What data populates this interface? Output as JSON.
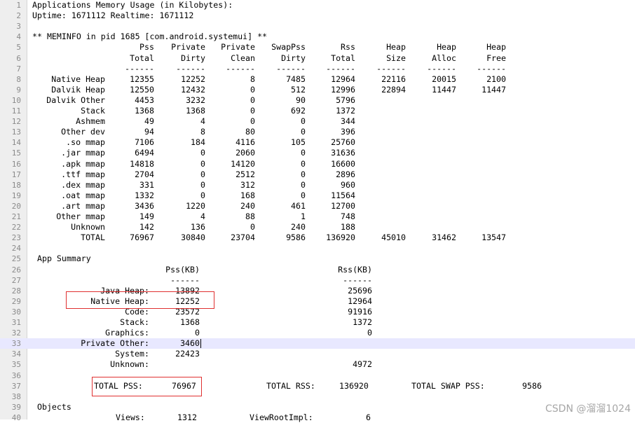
{
  "editor": {
    "lines": [
      {
        "n": "1",
        "text": "Applications Memory Usage (in Kilobytes):"
      },
      {
        "n": "2",
        "text": "Uptime: 1671112 Realtime: 1671112"
      },
      {
        "n": "3",
        "text": ""
      },
      {
        "n": "4",
        "text": "** MEMINFO in pid 1685 [com.android.systemui] **"
      },
      {
        "n": "5",
        "cols": [
          "",
          "Pss",
          "Private",
          "Private",
          "SwapPss",
          "Rss",
          "Heap",
          "Heap",
          "Heap"
        ]
      },
      {
        "n": "6",
        "cols": [
          "",
          "Total",
          "Dirty",
          "Clean",
          "Dirty",
          "Total",
          "Size",
          "Alloc",
          "Free"
        ]
      },
      {
        "n": "7",
        "cols": [
          "",
          "------",
          "------",
          "------",
          "------",
          "------",
          "------",
          "------",
          "------"
        ]
      },
      {
        "n": "8",
        "cols": [
          "Native Heap",
          "12355",
          "12252",
          "8",
          "7485",
          "12964",
          "22116",
          "20015",
          "2100"
        ]
      },
      {
        "n": "9",
        "cols": [
          "Dalvik Heap",
          "12550",
          "12432",
          "0",
          "512",
          "12996",
          "22894",
          "11447",
          "11447"
        ]
      },
      {
        "n": "10",
        "cols": [
          "Dalvik Other",
          "4453",
          "3232",
          "0",
          "90",
          "5796",
          "",
          "",
          ""
        ]
      },
      {
        "n": "11",
        "cols": [
          "Stack",
          "1368",
          "1368",
          "0",
          "692",
          "1372",
          "",
          "",
          ""
        ]
      },
      {
        "n": "12",
        "cols": [
          "Ashmem",
          "49",
          "4",
          "0",
          "0",
          "344",
          "",
          "",
          ""
        ]
      },
      {
        "n": "13",
        "cols": [
          "Other dev",
          "94",
          "8",
          "80",
          "0",
          "396",
          "",
          "",
          ""
        ]
      },
      {
        "n": "14",
        "cols": [
          ".so mmap",
          "7106",
          "184",
          "4116",
          "105",
          "25760",
          "",
          "",
          ""
        ]
      },
      {
        "n": "15",
        "cols": [
          ".jar mmap",
          "6494",
          "0",
          "2060",
          "0",
          "31636",
          "",
          "",
          ""
        ]
      },
      {
        "n": "16",
        "cols": [
          ".apk mmap",
          "14818",
          "0",
          "14120",
          "0",
          "16600",
          "",
          "",
          ""
        ]
      },
      {
        "n": "17",
        "cols": [
          ".ttf mmap",
          "2704",
          "0",
          "2512",
          "0",
          "2896",
          "",
          "",
          ""
        ]
      },
      {
        "n": "18",
        "cols": [
          ".dex mmap",
          "331",
          "0",
          "312",
          "0",
          "960",
          "",
          "",
          ""
        ]
      },
      {
        "n": "19",
        "cols": [
          ".oat mmap",
          "1332",
          "0",
          "168",
          "0",
          "11564",
          "",
          "",
          ""
        ]
      },
      {
        "n": "20",
        "cols": [
          ".art mmap",
          "3436",
          "1220",
          "240",
          "461",
          "12700",
          "",
          "",
          ""
        ]
      },
      {
        "n": "21",
        "cols": [
          "Other mmap",
          "149",
          "4",
          "88",
          "1",
          "748",
          "",
          "",
          ""
        ]
      },
      {
        "n": "22",
        "cols": [
          "Unknown",
          "142",
          "136",
          "0",
          "240",
          "188",
          "",
          "",
          ""
        ]
      },
      {
        "n": "23",
        "cols": [
          "TOTAL",
          "76967",
          "30840",
          "23704",
          "9586",
          "136920",
          "45010",
          "31462",
          "13547"
        ]
      },
      {
        "n": "24",
        "text": ""
      },
      {
        "n": "25",
        "text": " App Summary"
      },
      {
        "n": "26",
        "summary": [
          "",
          "Pss(KB)",
          "Rss(KB)"
        ]
      },
      {
        "n": "27",
        "summary": [
          "",
          "------",
          "------"
        ]
      },
      {
        "n": "28",
        "summary": [
          "Java Heap:",
          "13892",
          "25696"
        ]
      },
      {
        "n": "29",
        "summary": [
          "Native Heap:",
          "12252",
          "12964"
        ]
      },
      {
        "n": "30",
        "summary": [
          "Code:",
          "23572",
          "91916"
        ]
      },
      {
        "n": "31",
        "summary": [
          "Stack:",
          "1368",
          "1372"
        ]
      },
      {
        "n": "32",
        "summary": [
          "Graphics:",
          "0",
          "0"
        ]
      },
      {
        "n": "33",
        "summary": [
          "Private Other:",
          "3460",
          ""
        ]
      },
      {
        "n": "34",
        "summary": [
          "System:",
          "22423",
          ""
        ]
      },
      {
        "n": "35",
        "summary": [
          "Unknown:",
          "",
          "4972"
        ]
      },
      {
        "n": "36",
        "text": ""
      },
      {
        "n": "37",
        "totals": [
          "TOTAL PSS:",
          "76967",
          "TOTAL RSS:",
          "136920",
          "TOTAL SWAP PSS:",
          "9586"
        ]
      },
      {
        "n": "38",
        "text": ""
      },
      {
        "n": "39",
        "text": " Objects"
      },
      {
        "n": "40",
        "objects": [
          "Views:",
          "1312",
          "ViewRootImpl:",
          "6"
        ]
      }
    ],
    "current_line": "33",
    "colors": {
      "gutter_bg": "#eeeeee",
      "line_number": "#8a8a8a",
      "current_line_bg": "#e8e8ff",
      "annotation_box": "#e03030"
    }
  },
  "watermark": "CSDN @溜溜1024"
}
